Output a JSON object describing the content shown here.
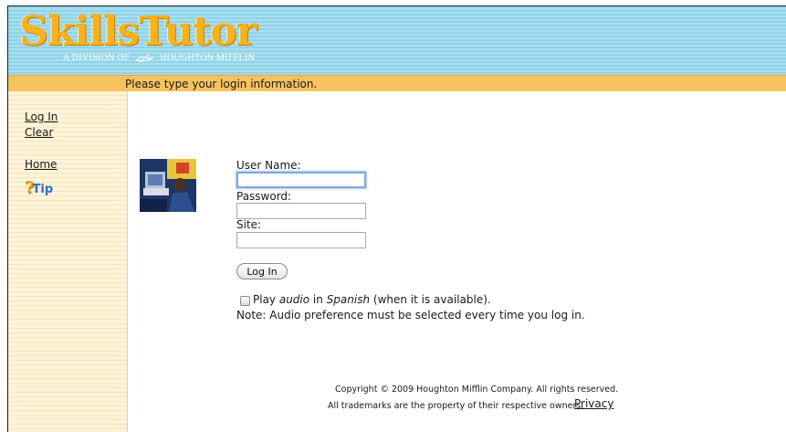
{
  "header": {
    "logo_text": "SkillsTutor",
    "logo_subtitle_left": "A DIVISION OF",
    "logo_subtitle_right": "HOUGHTON MIFFLIN"
  },
  "status": {
    "message": "Please type your login information."
  },
  "sidebar": {
    "login_link": "Log In",
    "clear_link": "Clear",
    "home_link": "Home",
    "tip_label": "Tip"
  },
  "form": {
    "username_label": "User Name:",
    "username_value": "",
    "password_label": "Password:",
    "password_value": "",
    "site_label": "Site:",
    "site_value": "",
    "login_button": "Log In",
    "audio_pre": "Play ",
    "audio_em1": "audio",
    "audio_mid": " in ",
    "audio_em2": "Spanish",
    "audio_post": " (when it is available).",
    "audio_checked": false,
    "note": "Note: Audio preference must be selected every time you log in."
  },
  "footer": {
    "copyright": "Copyright © 2009 Houghton Mifflin Company. All rights reserved.",
    "trademarks": "All trademarks are the property of their respective owners.",
    "privacy_link": "Privacy"
  },
  "colors": {
    "header_blue": "#a9dfef",
    "status_orange": "#f7c35f",
    "sidebar_cream": "#fdf3d8",
    "logo_gold": "#f4b21f"
  }
}
